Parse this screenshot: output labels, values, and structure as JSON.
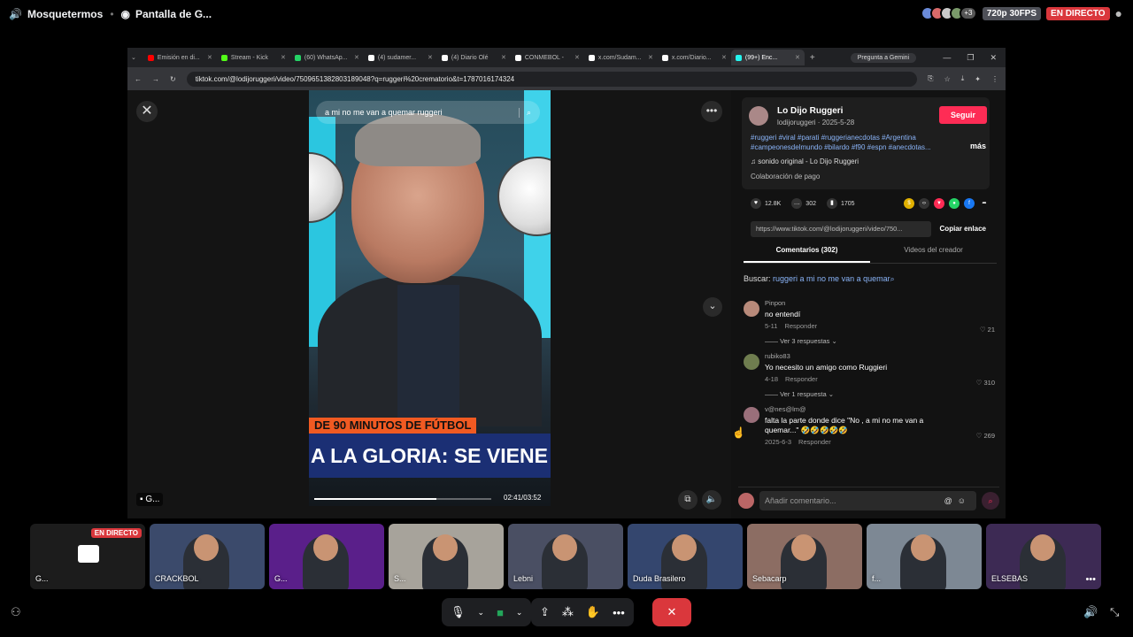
{
  "topbar": {
    "channel": "Mosquetermos",
    "stream": "Pantalla de G...",
    "extra_count": "+3",
    "quality": "720p 30FPS",
    "live": "EN DIRECTO"
  },
  "browser": {
    "tabs": [
      {
        "label": "Emisión en di...",
        "color": "#ff0000"
      },
      {
        "label": "Stream - Kick",
        "color": "#53fc18"
      },
      {
        "label": "(60) WhatsAp...",
        "color": "#25d366"
      },
      {
        "label": "(4) sudamer...",
        "color": "#ffffff"
      },
      {
        "label": "(4) Diario Olé",
        "color": "#ffffff"
      },
      {
        "label": "CONMEBOL -",
        "color": "#ffffff"
      },
      {
        "label": "x.com/Sudam...",
        "color": "#ffffff"
      },
      {
        "label": "x.com/Diario...",
        "color": "#ffffff"
      },
      {
        "label": "(99+) Enc...",
        "color": "#25f4ee",
        "active": true
      }
    ],
    "gemini": "Pregunta a Gemini",
    "url": "tiktok.com/@lodijoruggeri/video/7509651382803189048?q=ruggeri%20crematorio&t=1787016174324"
  },
  "video": {
    "search": "a mi no me van a quemar ruggeri",
    "banner_top": "DE 90 MINUTOS DE FÚTBOL",
    "banner_main": "A LA GLORIA: SE VIENE LA",
    "time": "02:41/03:52",
    "progress": 0.69,
    "overlay_label": "G..."
  },
  "post": {
    "author": "Lo Dijo Ruggeri",
    "handle_date": "lodijoruggeri · 2025-5-28",
    "follow": "Seguir",
    "tags": "#ruggeri #viral #parati #ruggerianecdotas #Argentina #campeonesdelmundo #bilardo #f90 #espn #anecdotas...",
    "more": "más",
    "sound": "sonido original - Lo Dijo Ruggeri",
    "paid": "Colaboración de pago",
    "likes": "12.8K",
    "comments": "302",
    "saves": "1705",
    "link": "https://www.tiktok.com/@lodijoruggeri/video/750...",
    "copy": "Copiar enlace",
    "tab_comments": "Comentarios (302)",
    "tab_creator": "Videos del creador",
    "search_label": "Buscar:",
    "search_query": "ruggeri a mi no me van a quemar",
    "comment_placeholder": "Añadir comentario..."
  },
  "comment_list": [
    {
      "user": "Pinpon",
      "text": "no entendí",
      "date": "5-11",
      "reply": "Responder",
      "likes": "21",
      "more": "Ver 3 respuestas",
      "color": "#b88a7a"
    },
    {
      "user": "rubiko83",
      "text": "Yo necesito un amigo como Ruggieri",
      "date": "4-18",
      "reply": "Responder",
      "likes": "310",
      "more": "Ver 1 respuesta",
      "color": "#6f7d4f"
    },
    {
      "user": "v@nes@lm@",
      "text": "falta la parte donde dice \"No , a mi no me van a quemar...\" 🤣🤣🤣🤣🤣",
      "date": "2025-6-3",
      "reply": "Responder",
      "likes": "269",
      "more": "",
      "color": "#9a6f7a"
    }
  ],
  "participants": [
    {
      "label": "G...",
      "live": "EN DIRECTO",
      "bg": "#1c1c1c",
      "is_screen": true
    },
    {
      "label": "CRACKBOL",
      "bg": "#3b4a6b"
    },
    {
      "label": "G...",
      "bg": "#5a1f8a"
    },
    {
      "label": "S...",
      "bg": "#a7a39b"
    },
    {
      "label": "Lebni",
      "bg": "#4a4f63"
    },
    {
      "label": "Duda Brasilero",
      "bg": "#34466e"
    },
    {
      "label": "Sebacarp",
      "bg": "#8c6d63"
    },
    {
      "label": "f...",
      "bg": "#7d8894"
    },
    {
      "label": "ELSEBAS",
      "bg": "#3d2a54"
    }
  ],
  "colors": {
    "live": "#da373c",
    "tiktok": "#fe2c55",
    "link": "#8ab4f8",
    "on": "#23a55a"
  }
}
